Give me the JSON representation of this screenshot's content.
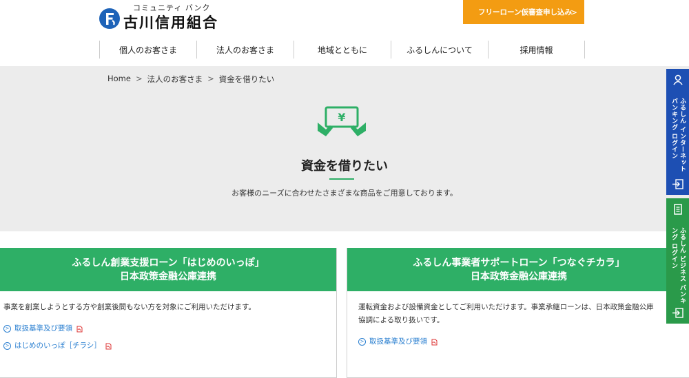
{
  "header": {
    "logo_sub": "コミュニティ バンク",
    "logo_main": "古川信用組合",
    "cta_label": "フリーローン仮審査申し込み",
    "nav": [
      "個人のお客さま",
      "法人のお客さま",
      "地域とともに",
      "ふるしんについて",
      "採用情報"
    ]
  },
  "breadcrumb": [
    "Home",
    "法人のお客さま",
    "資金を借りたい"
  ],
  "breadcrumb_sep": ">",
  "hero": {
    "title": "資金を借りたい",
    "description": "お客様のニーズに合わせたさまざまな商品をご用意しております。"
  },
  "cards": [
    {
      "title_line1": "ふるしん創業支援ローン「はじめのいっぽ」",
      "title_line2": "日本政策金融公庫連携",
      "body": "事業を創業しようとする方や創業後間もない方を対象にご利用いただけます。",
      "links": [
        "取扱基準及び要領",
        "はじめのいっぽ［チラシ］"
      ]
    },
    {
      "title_line1": "ふるしん事業者サポートローン「つなぐチカラ」",
      "title_line2": "日本政策金融公庫連携",
      "body_line1": "運転資金および設備資金としてご利用いただけます。事業承継ローンは、日本政策金融公庫",
      "body_line2": "協調による取り扱いです。",
      "links": [
        "取扱基準及び要領"
      ]
    }
  ],
  "side_tabs": [
    {
      "label_line1": "ふるしん インターネット",
      "label_line2": "バンキング ログイン",
      "icon": "person-icon",
      "color": "#1d4fb3"
    },
    {
      "label_line1": "ふるしん ビジネス",
      "label_line2": "バンキング ログイン",
      "icon": "building-icon",
      "color": "#2a9a4a"
    }
  ],
  "colors": {
    "accent_green": "#2eaf66",
    "cta_orange": "#f39c12",
    "link_blue": "#2a7fd0"
  }
}
